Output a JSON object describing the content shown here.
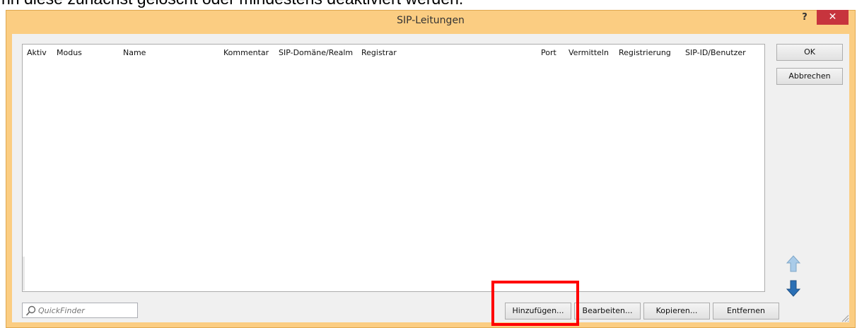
{
  "background_text": "nn diese zunächst gelöscht oder mindestens deaktiviert werden.",
  "window": {
    "title": "SIP-Leitungen",
    "help_label": "?",
    "close_label": "✕"
  },
  "table": {
    "columns": [
      "Aktiv",
      "Modus",
      "Name",
      "Kommentar",
      "SIP-Domäne/Realm",
      "Registrar",
      "Port",
      "Vermitteln",
      "Registrierung",
      "SIP-ID/Benutzer"
    ],
    "rows": []
  },
  "buttons": {
    "ok": "OK",
    "cancel": "Abbrechen",
    "add": "Hinzufügen...",
    "edit": "Bearbeiten...",
    "copy": "Kopieren...",
    "remove": "Entfernen"
  },
  "quickfinder": {
    "placeholder": "QuickFinder",
    "value": ""
  },
  "icons": {
    "up": "arrow-up-icon",
    "down": "arrow-down-icon",
    "search": "search-icon"
  },
  "colors": {
    "frame": "#fbcd82",
    "close": "#c7343d",
    "highlight": "#ff0000",
    "arrow_up": "#9cc2e5",
    "arrow_down": "#2a6fb5"
  }
}
